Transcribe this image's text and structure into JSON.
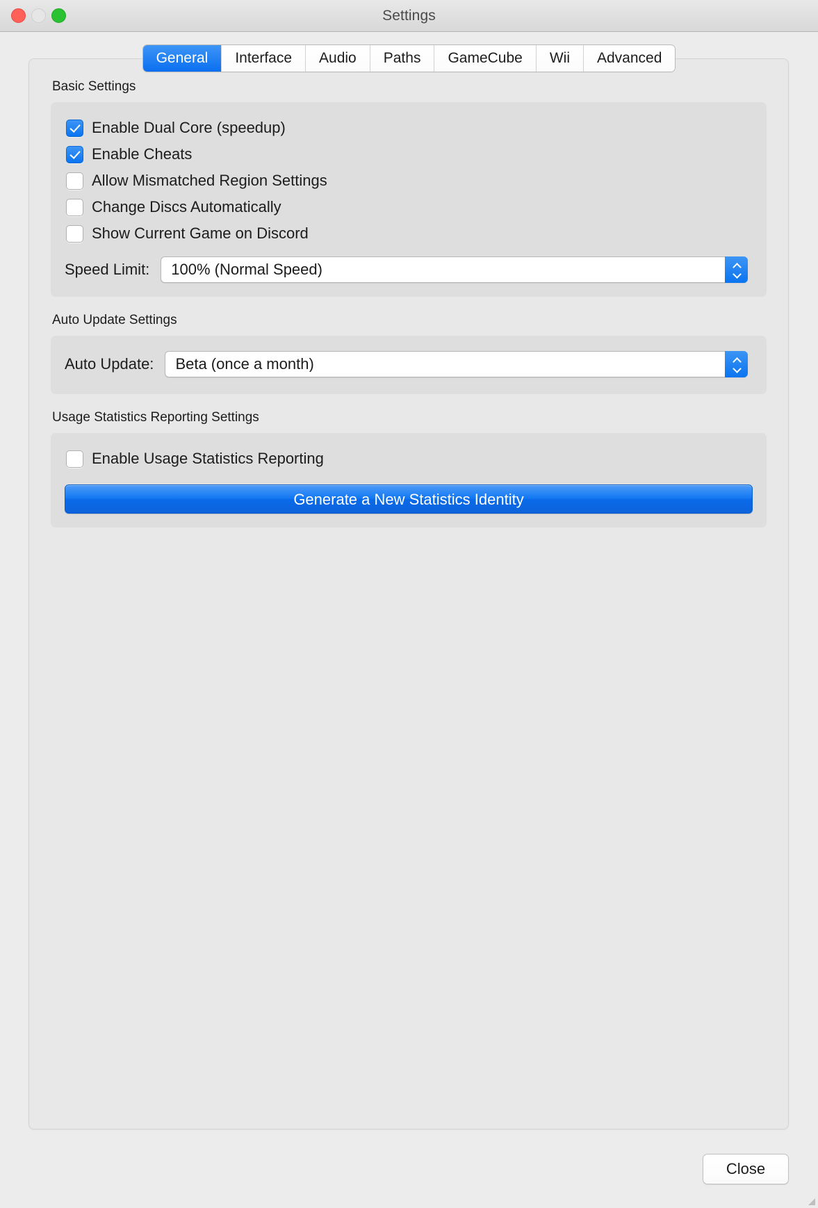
{
  "window": {
    "title": "Settings",
    "traffic_lights": [
      {
        "name": "close",
        "color": "#ff6159",
        "enabled": true
      },
      {
        "name": "minimize",
        "color": "#e6e6e6",
        "enabled": false
      },
      {
        "name": "zoom",
        "color": "#2ac231",
        "enabled": true
      }
    ]
  },
  "tabs": [
    {
      "label": "General",
      "selected": true
    },
    {
      "label": "Interface",
      "selected": false
    },
    {
      "label": "Audio",
      "selected": false
    },
    {
      "label": "Paths",
      "selected": false
    },
    {
      "label": "GameCube",
      "selected": false
    },
    {
      "label": "Wii",
      "selected": false
    },
    {
      "label": "Advanced",
      "selected": false
    }
  ],
  "basic_settings": {
    "group_label": "Basic Settings",
    "checkboxes": [
      {
        "label": "Enable Dual Core (speedup)",
        "checked": true
      },
      {
        "label": "Enable Cheats",
        "checked": true
      },
      {
        "label": "Allow Mismatched Region Settings",
        "checked": false
      },
      {
        "label": "Change Discs Automatically",
        "checked": false
      },
      {
        "label": "Show Current Game on Discord",
        "checked": false
      }
    ],
    "speed_limit": {
      "label": "Speed Limit:",
      "value": "100% (Normal Speed)"
    }
  },
  "auto_update_settings": {
    "group_label": "Auto Update Settings",
    "auto_update": {
      "label": "Auto Update:",
      "value": "Beta (once a month)"
    }
  },
  "usage_statistics_settings": {
    "group_label": "Usage Statistics Reporting Settings",
    "checkbox": {
      "label": "Enable Usage Statistics Reporting",
      "checked": false
    },
    "generate_button_label": "Generate a New Statistics Identity"
  },
  "footer": {
    "close_label": "Close"
  },
  "colors": {
    "accent_blue": "#0a74f0",
    "window_bg": "#ececec",
    "panel_bg": "#e8e8e8",
    "group_bg": "#dedede"
  }
}
